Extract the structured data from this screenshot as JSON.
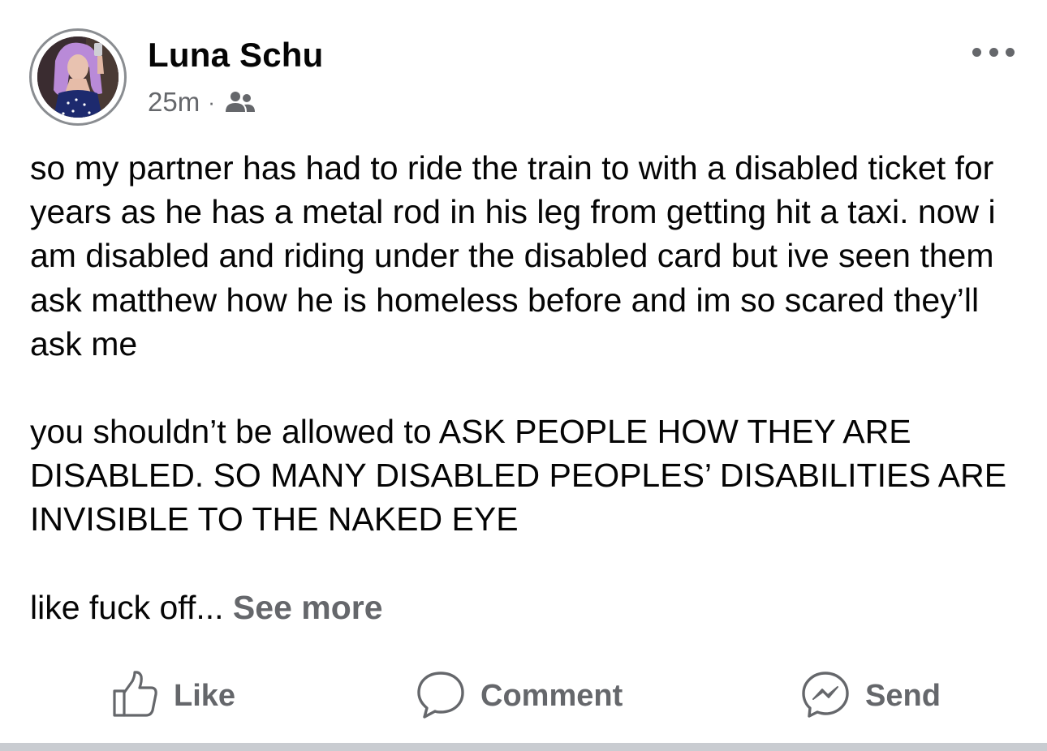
{
  "post": {
    "author": "Luna Schu",
    "time": "25m",
    "separator": "·",
    "audience_icon": "friends-icon",
    "more_icon": "more-options-icon",
    "paragraphs": [
      "so my partner has had to ride the train to with a disabled ticket for years as he has a metal rod in his leg from getting hit a taxi. now i am disabled and riding under the disabled card but ive seen them ask matthew how he is homeless before and im so scared they’ll ask me",
      "you shouldn’t be allowed to ASK PEOPLE HOW THEY ARE DISABLED. SO MANY DISABLED PEOPLES’ DISABILITIES ARE INVISIBLE TO THE NAKED EYE",
      "like fuck off..."
    ],
    "see_more": "See more"
  },
  "actions": {
    "like": {
      "label": "Like",
      "icon": "thumbs-up-icon"
    },
    "comment": {
      "label": "Comment",
      "icon": "comment-bubble-icon"
    },
    "send": {
      "label": "Send",
      "icon": "messenger-icon"
    }
  },
  "colors": {
    "text": "#050505",
    "secondary": "#65676b",
    "divider": "#c9ccd1"
  }
}
